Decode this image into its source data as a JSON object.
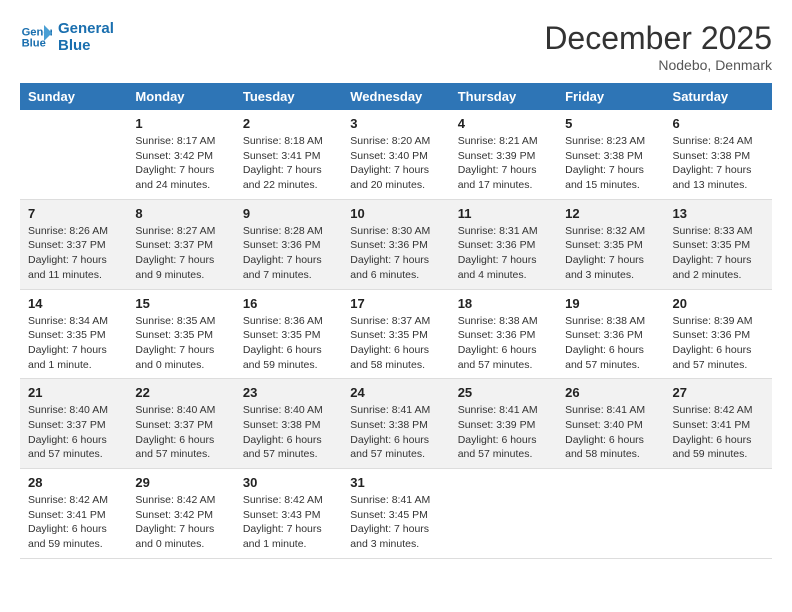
{
  "logo": {
    "line1": "General",
    "line2": "Blue"
  },
  "title": "December 2025",
  "location": "Nodebo, Denmark",
  "weekdays": [
    "Sunday",
    "Monday",
    "Tuesday",
    "Wednesday",
    "Thursday",
    "Friday",
    "Saturday"
  ],
  "weeks": [
    [
      {
        "day": "",
        "info": ""
      },
      {
        "day": "1",
        "info": "Sunrise: 8:17 AM\nSunset: 3:42 PM\nDaylight: 7 hours\nand 24 minutes."
      },
      {
        "day": "2",
        "info": "Sunrise: 8:18 AM\nSunset: 3:41 PM\nDaylight: 7 hours\nand 22 minutes."
      },
      {
        "day": "3",
        "info": "Sunrise: 8:20 AM\nSunset: 3:40 PM\nDaylight: 7 hours\nand 20 minutes."
      },
      {
        "day": "4",
        "info": "Sunrise: 8:21 AM\nSunset: 3:39 PM\nDaylight: 7 hours\nand 17 minutes."
      },
      {
        "day": "5",
        "info": "Sunrise: 8:23 AM\nSunset: 3:38 PM\nDaylight: 7 hours\nand 15 minutes."
      },
      {
        "day": "6",
        "info": "Sunrise: 8:24 AM\nSunset: 3:38 PM\nDaylight: 7 hours\nand 13 minutes."
      }
    ],
    [
      {
        "day": "7",
        "info": "Sunrise: 8:26 AM\nSunset: 3:37 PM\nDaylight: 7 hours\nand 11 minutes."
      },
      {
        "day": "8",
        "info": "Sunrise: 8:27 AM\nSunset: 3:37 PM\nDaylight: 7 hours\nand 9 minutes."
      },
      {
        "day": "9",
        "info": "Sunrise: 8:28 AM\nSunset: 3:36 PM\nDaylight: 7 hours\nand 7 minutes."
      },
      {
        "day": "10",
        "info": "Sunrise: 8:30 AM\nSunset: 3:36 PM\nDaylight: 7 hours\nand 6 minutes."
      },
      {
        "day": "11",
        "info": "Sunrise: 8:31 AM\nSunset: 3:36 PM\nDaylight: 7 hours\nand 4 minutes."
      },
      {
        "day": "12",
        "info": "Sunrise: 8:32 AM\nSunset: 3:35 PM\nDaylight: 7 hours\nand 3 minutes."
      },
      {
        "day": "13",
        "info": "Sunrise: 8:33 AM\nSunset: 3:35 PM\nDaylight: 7 hours\nand 2 minutes."
      }
    ],
    [
      {
        "day": "14",
        "info": "Sunrise: 8:34 AM\nSunset: 3:35 PM\nDaylight: 7 hours\nand 1 minute."
      },
      {
        "day": "15",
        "info": "Sunrise: 8:35 AM\nSunset: 3:35 PM\nDaylight: 7 hours\nand 0 minutes."
      },
      {
        "day": "16",
        "info": "Sunrise: 8:36 AM\nSunset: 3:35 PM\nDaylight: 6 hours\nand 59 minutes."
      },
      {
        "day": "17",
        "info": "Sunrise: 8:37 AM\nSunset: 3:35 PM\nDaylight: 6 hours\nand 58 minutes."
      },
      {
        "day": "18",
        "info": "Sunrise: 8:38 AM\nSunset: 3:36 PM\nDaylight: 6 hours\nand 57 minutes."
      },
      {
        "day": "19",
        "info": "Sunrise: 8:38 AM\nSunset: 3:36 PM\nDaylight: 6 hours\nand 57 minutes."
      },
      {
        "day": "20",
        "info": "Sunrise: 8:39 AM\nSunset: 3:36 PM\nDaylight: 6 hours\nand 57 minutes."
      }
    ],
    [
      {
        "day": "21",
        "info": "Sunrise: 8:40 AM\nSunset: 3:37 PM\nDaylight: 6 hours\nand 57 minutes."
      },
      {
        "day": "22",
        "info": "Sunrise: 8:40 AM\nSunset: 3:37 PM\nDaylight: 6 hours\nand 57 minutes."
      },
      {
        "day": "23",
        "info": "Sunrise: 8:40 AM\nSunset: 3:38 PM\nDaylight: 6 hours\nand 57 minutes."
      },
      {
        "day": "24",
        "info": "Sunrise: 8:41 AM\nSunset: 3:38 PM\nDaylight: 6 hours\nand 57 minutes."
      },
      {
        "day": "25",
        "info": "Sunrise: 8:41 AM\nSunset: 3:39 PM\nDaylight: 6 hours\nand 57 minutes."
      },
      {
        "day": "26",
        "info": "Sunrise: 8:41 AM\nSunset: 3:40 PM\nDaylight: 6 hours\nand 58 minutes."
      },
      {
        "day": "27",
        "info": "Sunrise: 8:42 AM\nSunset: 3:41 PM\nDaylight: 6 hours\nand 59 minutes."
      }
    ],
    [
      {
        "day": "28",
        "info": "Sunrise: 8:42 AM\nSunset: 3:41 PM\nDaylight: 6 hours\nand 59 minutes."
      },
      {
        "day": "29",
        "info": "Sunrise: 8:42 AM\nSunset: 3:42 PM\nDaylight: 7 hours\nand 0 minutes."
      },
      {
        "day": "30",
        "info": "Sunrise: 8:42 AM\nSunset: 3:43 PM\nDaylight: 7 hours\nand 1 minute."
      },
      {
        "day": "31",
        "info": "Sunrise: 8:41 AM\nSunset: 3:45 PM\nDaylight: 7 hours\nand 3 minutes."
      },
      {
        "day": "",
        "info": ""
      },
      {
        "day": "",
        "info": ""
      },
      {
        "day": "",
        "info": ""
      }
    ]
  ]
}
